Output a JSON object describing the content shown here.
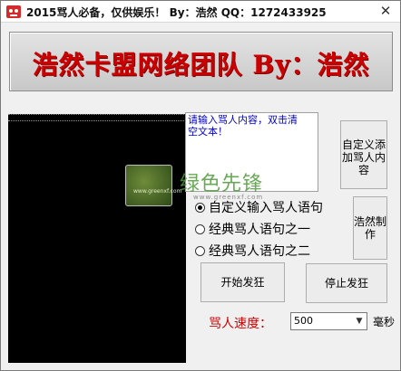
{
  "window": {
    "title": "2015骂人必备，仅供娱乐！ By：浩然 QQ：1272433925",
    "close_glyph": "✕"
  },
  "banner": {
    "text": "浩然卡盟网络团队 By：浩然"
  },
  "message_box": {
    "text": "请输入骂人内容，双击清空文本！"
  },
  "buttons": {
    "custom_add": "自定义添加骂人内容",
    "make": "浩然制作",
    "start": "开始发狂",
    "stop": "停止发狂"
  },
  "modes": [
    {
      "label": "自定义输入骂人语句",
      "selected": true
    },
    {
      "label": "经典骂人语句之一",
      "selected": false
    },
    {
      "label": "经典骂人语句之二",
      "selected": false
    }
  ],
  "speed": {
    "label": "骂人速度：",
    "value": "500",
    "unit": "毫秒"
  },
  "watermark": {
    "text": "绿色先锋",
    "url": "www.greenxf.com"
  },
  "preview_logo": {
    "text": "www.greenxf.com"
  },
  "colors": {
    "banner_text": "#cc0000",
    "speed_label": "#cc0000",
    "hint_text": "#0000cc"
  }
}
